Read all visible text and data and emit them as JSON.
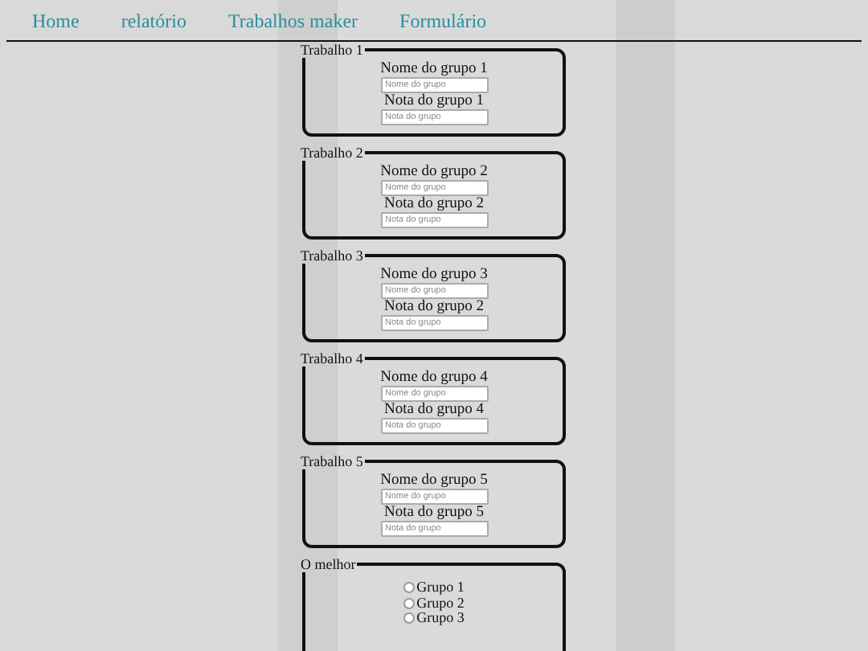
{
  "nav": [
    {
      "label": "Home"
    },
    {
      "label": "relatório"
    },
    {
      "label": "Trabalhos maker"
    },
    {
      "label": "Formulário"
    }
  ],
  "trabalhos": [
    {
      "legend": "Trabalho 1",
      "name_label": "Nome do grupo 1",
      "name_placeholder": "Nome do grupo",
      "grade_label": "Nota do grupo 1",
      "grade_placeholder": "Nota do grupo"
    },
    {
      "legend": "Trabalho 2",
      "name_label": "Nome do grupo 2",
      "name_placeholder": "Nome do grupo",
      "grade_label": "Nota do grupo 2",
      "grade_placeholder": "Nota do grupo"
    },
    {
      "legend": "Trabalho 3",
      "name_label": "Nome do grupo 3",
      "name_placeholder": "Nome do grupo",
      "grade_label": "Nota do grupo 2",
      "grade_placeholder": "Nota do grupo"
    },
    {
      "legend": "Trabalho 4",
      "name_label": "Nome do grupo 4",
      "name_placeholder": "Nome do grupo",
      "grade_label": "Nota do grupo 4",
      "grade_placeholder": "Nota do grupo"
    },
    {
      "legend": "Trabalho 5",
      "name_label": "Nome do grupo 5",
      "name_placeholder": "Nome do grupo",
      "grade_label": "Nota do grupo 5",
      "grade_placeholder": "Nota do grupo"
    }
  ],
  "best": {
    "legend": "O melhor",
    "options": [
      {
        "label": "Grupo 1",
        "selected": false
      },
      {
        "label": "Grupo 2",
        "selected": false
      },
      {
        "label": "Grupo 3",
        "selected": false
      }
    ]
  }
}
